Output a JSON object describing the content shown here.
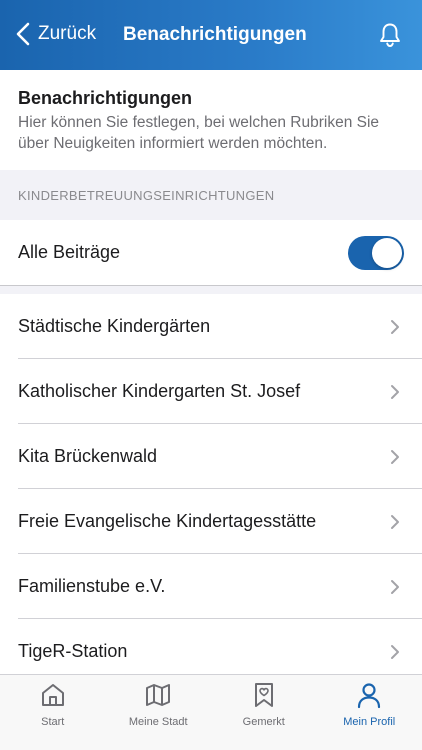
{
  "navbar": {
    "back_label": "Zurück",
    "title": "Benachrichtigungen"
  },
  "intro": {
    "title": "Benachrichtigungen",
    "description": "Hier können Sie festlegen, bei welchen Rubriken Sie über Neuigkeiten informiert werden möchten."
  },
  "section": {
    "header": "KINDERBETREUUNGSEINRICHTUNGEN",
    "all_posts": {
      "label": "Alle Beiträge",
      "enabled": true
    }
  },
  "items": [
    {
      "label": "Städtische Kindergärten"
    },
    {
      "label": "Katholischer Kindergarten St. Josef"
    },
    {
      "label": "Kita Brückenwald"
    },
    {
      "label": "Freie Evangelische Kindertagesstätte"
    },
    {
      "label": "Familienstube e.V."
    },
    {
      "label": "TigeR-Station"
    }
  ],
  "tabbar": {
    "tabs": [
      {
        "label": "Start",
        "icon": "home-icon"
      },
      {
        "label": "Meine Stadt",
        "icon": "map-icon"
      },
      {
        "label": "Gemerkt",
        "icon": "bookmark-heart-icon"
      },
      {
        "label": "Mein Profil",
        "icon": "person-icon",
        "active": true
      }
    ]
  },
  "colors": {
    "accent": "#1a64ae",
    "header_gradient_end": "#3a93db",
    "section_background": "#f2f2f7",
    "secondary_text": "#6d6d72"
  }
}
